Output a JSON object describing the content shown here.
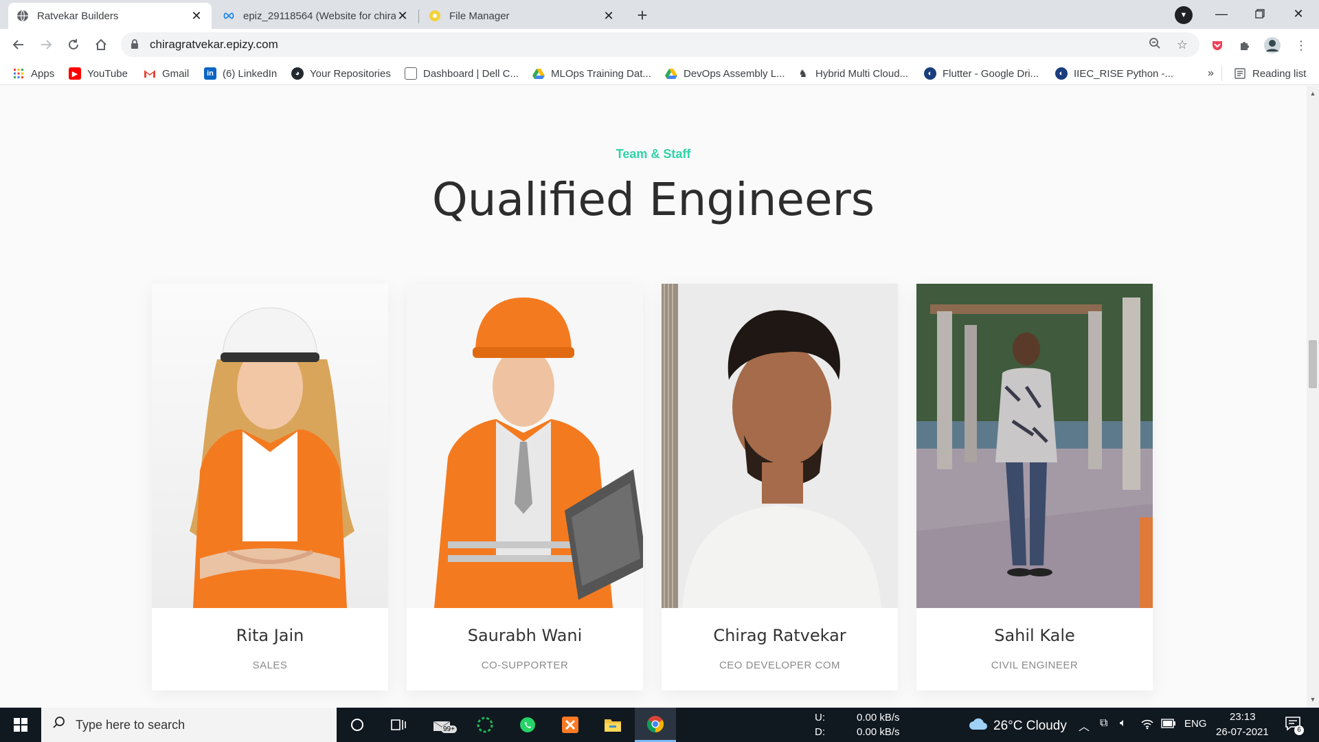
{
  "browser": {
    "tabs": [
      {
        "title": "Ratvekar Builders",
        "active": true
      },
      {
        "title": "epiz_29118564 (Website for chira",
        "active": false
      },
      {
        "title": "File Manager",
        "active": false
      }
    ],
    "url": "chiragratvekar.epizy.com"
  },
  "bookmarks": [
    {
      "label": "Apps",
      "icon": "apps-grid-icon",
      "color": "#ea4335"
    },
    {
      "label": "YouTube",
      "icon": "youtube-icon",
      "color": "#ff0000"
    },
    {
      "label": "Gmail",
      "icon": "gmail-icon",
      "color": "#ea4335"
    },
    {
      "label": "(6) LinkedIn",
      "icon": "linkedin-icon",
      "color": "#0a66c2"
    },
    {
      "label": "Your Repositories",
      "icon": "github-icon",
      "color": "#24292e"
    },
    {
      "label": "Dashboard | Dell C...",
      "icon": "page-icon",
      "color": "#ffffff"
    },
    {
      "label": "MLOps Training Dat...",
      "icon": "drive-icon",
      "color": "#fbbc04"
    },
    {
      "label": "DevOps Assembly L...",
      "icon": "drive-icon",
      "color": "#fbbc04"
    },
    {
      "label": "Hybrid Multi Cloud...",
      "icon": "person-icon",
      "color": "#5f6368"
    },
    {
      "label": "Flutter - Google Dri...",
      "icon": "globe-icon",
      "color": "#1a3d7c"
    },
    {
      "label": "IIEC_RISE Python -...",
      "icon": "globe-icon",
      "color": "#1a3d7c"
    }
  ],
  "reading_list": "Reading list",
  "overflow": "»",
  "section": {
    "subtitle": "Team & Staff",
    "title": "Qualified Engineers"
  },
  "team": [
    {
      "name": "Rita Jain",
      "role": "SALES"
    },
    {
      "name": "Saurabh Wani",
      "role": "CO-SUPPORTER"
    },
    {
      "name": "Chirag Ratvekar",
      "role": "CEO DEVELOPER COM"
    },
    {
      "name": "Sahil Kale",
      "role": "CIVIL ENGINEER"
    }
  ],
  "colors": {
    "accent": "#2fd3a8",
    "heading": "#2d2d2d"
  },
  "taskbar": {
    "search_placeholder": "Type here to search",
    "mail_badge": "99+",
    "net_up_label": "U:",
    "net_down_label": "D:",
    "net_up": "0.00 kB/s",
    "net_down": "0.00 kB/s",
    "weather": "26°C  Cloudy",
    "lang": "ENG",
    "time": "23:13",
    "date": "26-07-2021",
    "notifications": "6"
  }
}
